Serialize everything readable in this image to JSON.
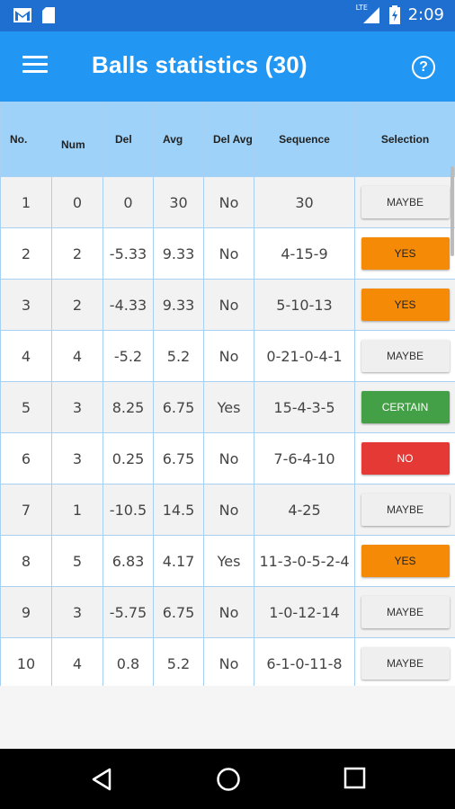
{
  "status_bar": {
    "time": "2:09",
    "network": "LTE",
    "left_icons": [
      "gmail-icon",
      "sd-card-icon"
    ],
    "right_icons": [
      "signal-icon",
      "battery-icon"
    ]
  },
  "app_bar": {
    "title": "Balls statistics (30)",
    "menu_icon": "menu-icon",
    "help_icon": "help-icon",
    "help_glyph": "?"
  },
  "table": {
    "headers": [
      "No.",
      "Num",
      "Del",
      "Avg",
      "Del Avg",
      "Sequence",
      "Selection"
    ],
    "rows": [
      {
        "no": "1",
        "num": "0",
        "del": "0",
        "avg": "30",
        "del_avg": "No",
        "sequence": "30",
        "selection": "MAYBE"
      },
      {
        "no": "2",
        "num": "2",
        "del": "-5.33",
        "avg": "9.33",
        "del_avg": "No",
        "sequence": "4-15-9",
        "selection": "YES"
      },
      {
        "no": "3",
        "num": "2",
        "del": "-4.33",
        "avg": "9.33",
        "del_avg": "No",
        "sequence": "5-10-13",
        "selection": "YES"
      },
      {
        "no": "4",
        "num": "4",
        "del": "-5.2",
        "avg": "5.2",
        "del_avg": "No",
        "sequence": "0-21-0-4-1",
        "selection": "MAYBE"
      },
      {
        "no": "5",
        "num": "3",
        "del": "8.25",
        "avg": "6.75",
        "del_avg": "Yes",
        "sequence": "15-4-3-5",
        "selection": "CERTAIN"
      },
      {
        "no": "6",
        "num": "3",
        "del": "0.25",
        "avg": "6.75",
        "del_avg": "No",
        "sequence": "7-6-4-10",
        "selection": "NO"
      },
      {
        "no": "7",
        "num": "1",
        "del": "-10.5",
        "avg": "14.5",
        "del_avg": "No",
        "sequence": "4-25",
        "selection": "MAYBE"
      },
      {
        "no": "8",
        "num": "5",
        "del": "6.83",
        "avg": "4.17",
        "del_avg": "Yes",
        "sequence": "11-3-0-5-2-4",
        "selection": "YES"
      },
      {
        "no": "9",
        "num": "3",
        "del": "-5.75",
        "avg": "6.75",
        "del_avg": "No",
        "sequence": "1-0-12-14",
        "selection": "MAYBE"
      },
      {
        "no": "10",
        "num": "4",
        "del": "0.8",
        "avg": "5.2",
        "del_avg": "No",
        "sequence": "6-1-0-11-8",
        "selection": "MAYBE"
      }
    ]
  },
  "selection_colors": {
    "MAYBE": "#efefef",
    "YES": "#f58a07",
    "CERTAIN": "#43a047",
    "NO": "#e53935"
  },
  "colors": {
    "status_bar": "#1e6fd0",
    "app_bar": "#2196f3",
    "header_bg": "#9ed2f8"
  },
  "nav_bar": {
    "icons": [
      "back-icon",
      "home-icon",
      "recent-apps-icon"
    ]
  }
}
